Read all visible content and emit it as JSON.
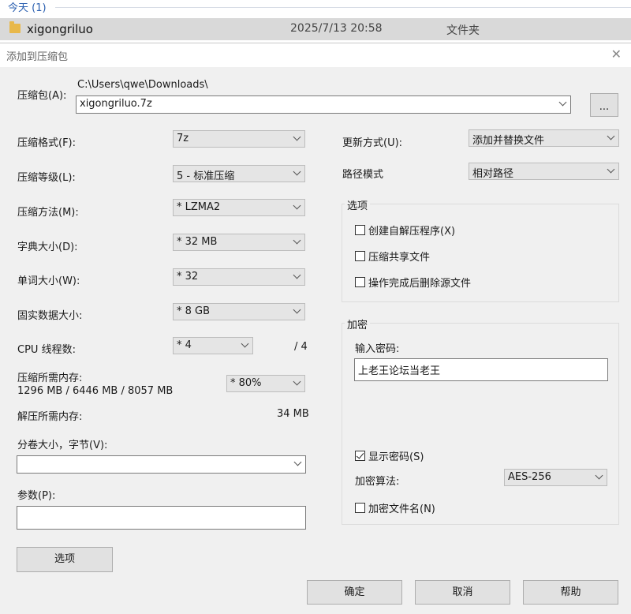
{
  "explorer": {
    "group_header": "今天 (1)",
    "file": {
      "name": "xigongriluo",
      "date": "2025/7/13 20:58",
      "type": "文件夹"
    }
  },
  "dialog": {
    "title": "添加到压缩包",
    "archive": {
      "label": "压缩包(A):",
      "path": "C:\\Users\\qwe\\Downloads\\",
      "name": "xigongriluo.7z",
      "browse_label": "..."
    },
    "left": {
      "format": {
        "label": "压缩格式(F):",
        "value": "7z"
      },
      "level": {
        "label": "压缩等级(L):",
        "value": "5 - 标准压缩"
      },
      "method": {
        "label": "压缩方法(M):",
        "value": "* LZMA2"
      },
      "dict": {
        "label": "字典大小(D):",
        "value": "* 32 MB"
      },
      "word": {
        "label": "单词大小(W):",
        "value": "* 32"
      },
      "solid": {
        "label": "固实数据大小:",
        "value": "* 8 GB"
      },
      "threads": {
        "label": "CPU 线程数:",
        "value": "* 4",
        "max": "/ 4"
      },
      "mem_compress": {
        "label": "压缩所需内存:",
        "detail": "1296 MB / 6446 MB / 8057 MB",
        "value": "* 80%"
      },
      "mem_decompress": {
        "label": "解压所需内存:",
        "value": "34 MB"
      },
      "volume": {
        "label": "分卷大小，字节(V):",
        "value": ""
      },
      "params": {
        "label": "参数(P):",
        "value": ""
      },
      "options_button": "选项"
    },
    "right": {
      "update": {
        "label": "更新方式(U):",
        "value": "添加并替换文件"
      },
      "path_mode": {
        "label": "路径模式",
        "value": "相对路径"
      },
      "options_group": {
        "title": "选项",
        "sfx": "创建自解压程序(X)",
        "shared": "压缩共享文件",
        "delete": "操作完成后删除源文件"
      },
      "encryption": {
        "title": "加密",
        "password_label": "输入密码:",
        "password_value": "上老王论坛当老王",
        "show_password": "显示密码(S)",
        "method_label": "加密算法:",
        "method_value": "AES-256",
        "encrypt_names": "加密文件名(N)"
      }
    },
    "buttons": {
      "ok": "确定",
      "cancel": "取消",
      "help": "帮助"
    }
  }
}
